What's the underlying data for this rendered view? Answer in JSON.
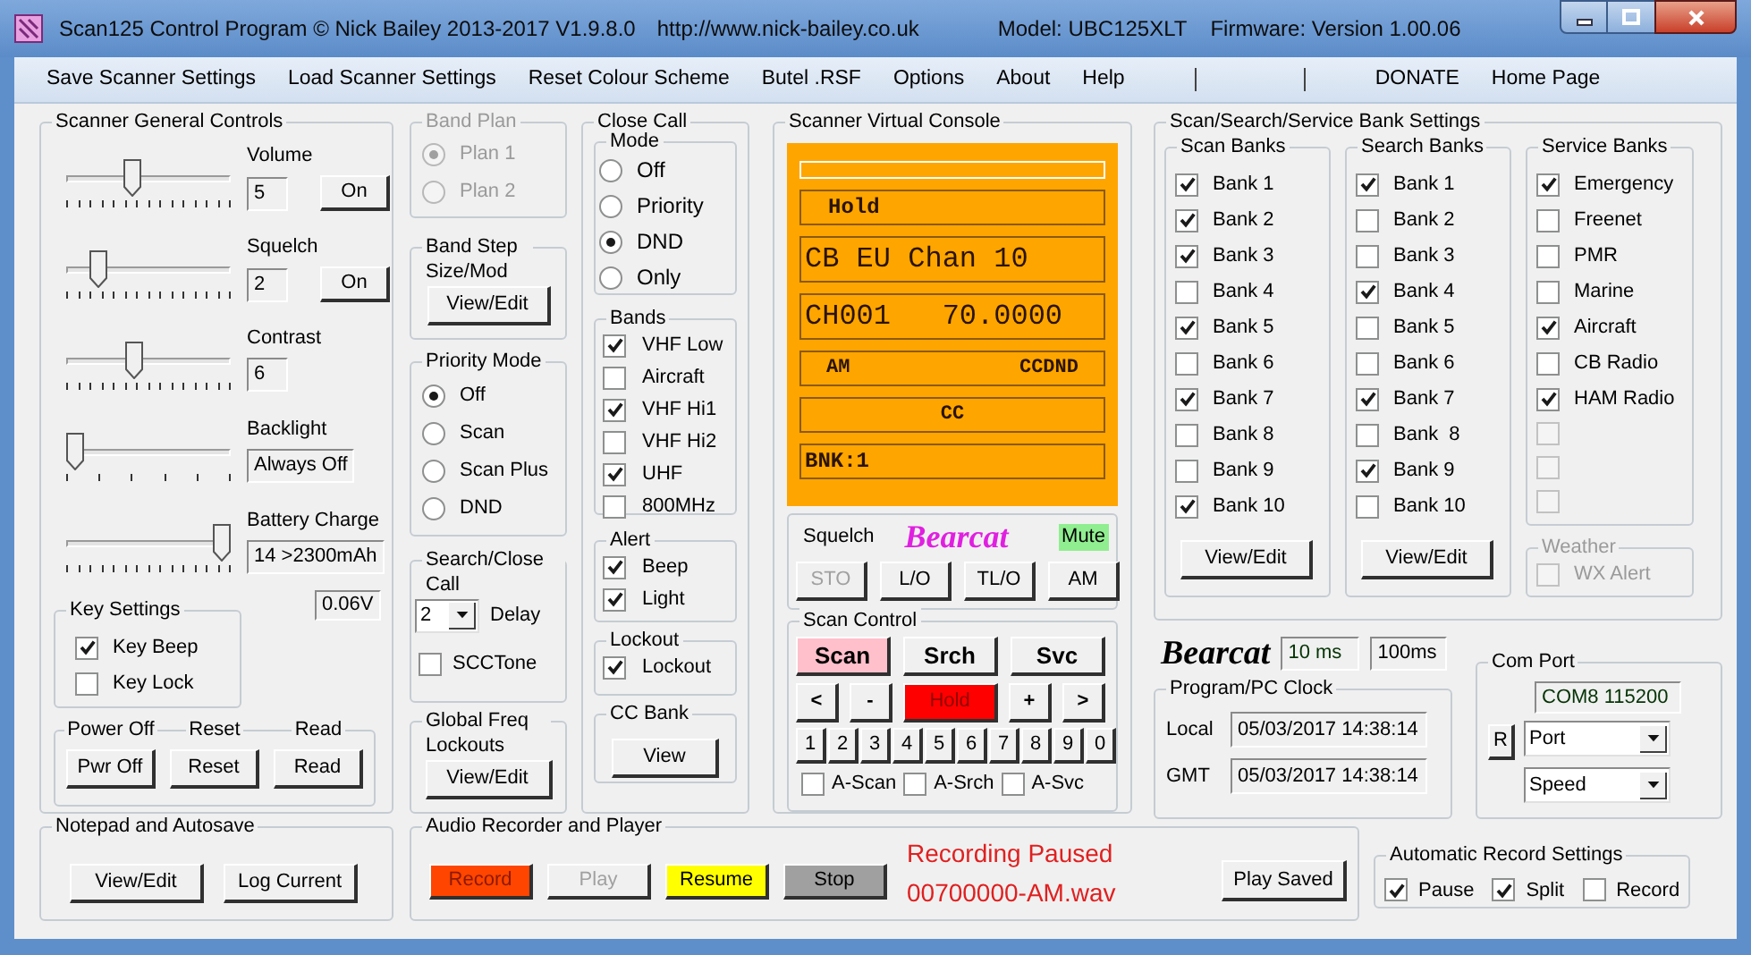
{
  "window": {
    "title": "Scan125 Control Program © Nick Bailey 2013-2017 V1.9.8.0",
    "url": "http://www.nick-bailey.co.uk",
    "model": "Model: UBC125XLT",
    "firmware": "Firmware: Version 1.00.06"
  },
  "menu": [
    {
      "kind": "item",
      "label": "Save Scanner Settings"
    },
    {
      "kind": "item",
      "label": "Load Scanner Settings"
    },
    {
      "kind": "item",
      "label": "Reset Colour Scheme"
    },
    {
      "kind": "item",
      "label": "Butel .RSF"
    },
    {
      "kind": "item",
      "label": "Options"
    },
    {
      "kind": "item",
      "label": "About"
    },
    {
      "kind": "item",
      "label": "Help"
    },
    {
      "kind": "separator"
    },
    {
      "kind": "separator"
    },
    {
      "kind": "item",
      "label": "DONATE"
    },
    {
      "kind": "item",
      "label": "Home Page"
    }
  ],
  "general_controls": {
    "title": "Scanner General Controls",
    "sliders": [
      {
        "kind": "fine",
        "label": "Volume",
        "level": 0.39,
        "value": "5",
        "button": "On"
      },
      {
        "kind": "fine",
        "label": "Squelch",
        "level": 0.16,
        "value": "2",
        "button": "On"
      },
      {
        "kind": "fine",
        "label": "Contrast",
        "level": 0.4,
        "value": "6"
      },
      {
        "kind": "coarse",
        "label": "Backlight",
        "level": 0,
        "value": "Always Off"
      },
      {
        "kind": "fine",
        "label": "Battery Charge",
        "level": 1,
        "value": "14 >2300mAh"
      }
    ],
    "voltage": "0.06V",
    "key_settings": {
      "title": "Key Settings",
      "items": [
        {
          "label": "Key Beep",
          "checked": true
        },
        {
          "label": "Key Lock",
          "checked": false
        }
      ]
    },
    "power": [
      {
        "label": "Power Off",
        "button": "Pwr Off"
      },
      {
        "label": "Reset",
        "button": "Reset"
      },
      {
        "label": "Read",
        "button": "Read"
      }
    ]
  },
  "band_plan": {
    "title": "Band Plan",
    "disabled": true,
    "options": [
      {
        "label": "Plan 1",
        "selected": true
      },
      {
        "label": "Plan 2",
        "selected": false
      }
    ]
  },
  "band_step": {
    "title": "Band Step Size/Mod",
    "button": "View/Edit"
  },
  "priority_mode": {
    "title": "Priority Mode",
    "options": [
      {
        "label": "Off",
        "selected": true
      },
      {
        "label": "Scan",
        "selected": false
      },
      {
        "label": "Scan Plus",
        "selected": false
      },
      {
        "label": "DND",
        "selected": false
      }
    ]
  },
  "search_close_call": {
    "title": "Search/Close Call",
    "delay_value": "2",
    "delay_label": "Delay",
    "scc_tone": {
      "label": "SCCTone",
      "checked": false
    }
  },
  "global_lockouts": {
    "title": "Global Freq Lockouts",
    "button": "View/Edit"
  },
  "close_call": {
    "title": "Close Call",
    "mode": {
      "title": "Mode",
      "options": [
        {
          "label": "Off",
          "selected": false
        },
        {
          "label": "Priority",
          "selected": false
        },
        {
          "label": "DND",
          "selected": true
        },
        {
          "label": "Only",
          "selected": false
        }
      ]
    },
    "bands": {
      "title": "Bands",
      "items": [
        {
          "label": "VHF Low",
          "checked": true
        },
        {
          "label": "Aircraft",
          "checked": false
        },
        {
          "label": "VHF Hi1",
          "checked": true
        },
        {
          "label": "VHF Hi2",
          "checked": false
        },
        {
          "label": "UHF",
          "checked": true
        },
        {
          "label": "800MHz",
          "checked": false
        }
      ]
    },
    "alert": {
      "title": "Alert",
      "items": [
        {
          "label": "Beep",
          "checked": true
        },
        {
          "label": "Light",
          "checked": true
        }
      ]
    },
    "lockout": {
      "title": "Lockout",
      "items": [
        {
          "label": "Lockout",
          "checked": true
        }
      ]
    },
    "cc_bank": {
      "title": "CC Bank",
      "button": "View"
    }
  },
  "console": {
    "title": "Scanner Virtual Console",
    "display": [
      {
        "kind": "blank"
      },
      {
        "kind": "status",
        "text": "Hold"
      },
      {
        "kind": "large",
        "text": "CB EU Chan 10"
      },
      {
        "kind": "large",
        "text": "CH001   70.0000"
      },
      {
        "kind": "split",
        "left": "AM",
        "right": "CCDND"
      },
      {
        "kind": "center",
        "text": "CC"
      },
      {
        "kind": "plain",
        "text": "BNK:1"
      }
    ],
    "squelch_label": "Squelch",
    "logo": "Bearcat",
    "mute": "Mute",
    "keys": [
      {
        "label": "STO",
        "disabled": true
      },
      {
        "label": "L/O",
        "disabled": false
      },
      {
        "label": "TL/O",
        "disabled": false
      },
      {
        "label": "AM",
        "disabled": false
      }
    ],
    "scan_control": {
      "title": "Scan Control",
      "modes": [
        {
          "label": "Scan",
          "color": "#ffc0cb"
        },
        {
          "label": "Srch",
          "color": "#f0f0f0"
        },
        {
          "label": "Svc",
          "color": "#f0f0f0"
        }
      ],
      "nav": [
        {
          "label": "<",
          "color": "#f0f0f0"
        },
        {
          "label": "-",
          "color": "#f0f0f0"
        },
        {
          "label": "Hold",
          "color": "#ff0000"
        },
        {
          "label": "+",
          "color": "#f0f0f0"
        },
        {
          "label": ">",
          "color": "#f0f0f0"
        }
      ],
      "digits": [
        "1",
        "2",
        "3",
        "4",
        "5",
        "6",
        "7",
        "8",
        "9",
        "0"
      ],
      "auto": [
        {
          "label": "A-Scan",
          "checked": false
        },
        {
          "label": "A-Srch",
          "checked": false
        },
        {
          "label": "A-Svc",
          "checked": false
        }
      ]
    }
  },
  "bank_settings": {
    "title": "Scan/Search/Service Bank Settings",
    "scan_banks": {
      "title": "Scan Banks",
      "button": "View/Edit",
      "items": [
        {
          "label": "Bank 1",
          "checked": true
        },
        {
          "label": "Bank 2",
          "checked": true
        },
        {
          "label": "Bank 3",
          "checked": true
        },
        {
          "label": "Bank 4",
          "checked": false
        },
        {
          "label": "Bank 5",
          "checked": true
        },
        {
          "label": "Bank 6",
          "checked": false
        },
        {
          "label": "Bank 7",
          "checked": true
        },
        {
          "label": "Bank 8",
          "checked": false
        },
        {
          "label": "Bank 9",
          "checked": false
        },
        {
          "label": "Bank 10",
          "checked": true
        }
      ]
    },
    "search_banks": {
      "title": "Search Banks",
      "button": "View/Edit",
      "items": [
        {
          "label": "Bank 1",
          "checked": true
        },
        {
          "label": "Bank 2",
          "checked": false
        },
        {
          "label": "Bank 3",
          "checked": false
        },
        {
          "label": "Bank 4",
          "checked": true
        },
        {
          "label": "Bank 5",
          "checked": false
        },
        {
          "label": "Bank 6",
          "checked": false
        },
        {
          "label": "Bank 7",
          "checked": true
        },
        {
          "label": "Bank  8",
          "checked": false
        },
        {
          "label": "Bank 9",
          "checked": true
        },
        {
          "label": "Bank 10",
          "checked": false
        }
      ]
    },
    "service_banks": {
      "title": "Service Banks",
      "items": [
        {
          "label": "Emergency",
          "checked": true,
          "disabled": false
        },
        {
          "label": "Freenet",
          "checked": false,
          "disabled": false
        },
        {
          "label": "PMR",
          "checked": false,
          "disabled": false
        },
        {
          "label": "Marine",
          "checked": false,
          "disabled": false
        },
        {
          "label": "Aircraft",
          "checked": true,
          "disabled": false
        },
        {
          "label": "CB Radio",
          "checked": false,
          "disabled": false
        },
        {
          "label": "HAM Radio",
          "checked": true,
          "disabled": false
        },
        {
          "checked": false,
          "disabled": true
        },
        {
          "checked": false,
          "disabled": true
        },
        {
          "checked": false,
          "disabled": true
        }
      ]
    },
    "weather": {
      "title": "Weather",
      "items": [
        {
          "label": "WX Alert",
          "checked": false,
          "disabled": true
        }
      ]
    }
  },
  "timing": {
    "logo": "Bearcat",
    "fast": "10 ms",
    "slow": "100ms"
  },
  "clock": {
    "title": "Program/PC Clock",
    "rows": [
      {
        "label": "Local",
        "value": "05/03/2017 14:38:14"
      },
      {
        "label": "GMT",
        "value": "05/03/2017 14:38:14"
      }
    ]
  },
  "com_port": {
    "title": "Com Port",
    "status": "COM8 115200",
    "reset": "R",
    "port": "Port",
    "speed": "Speed"
  },
  "notepad": {
    "title": "Notepad and Autosave",
    "buttons": [
      "View/Edit",
      "Log Current"
    ]
  },
  "recorder": {
    "title": "Audio Recorder and Player",
    "buttons": [
      {
        "label": "Record",
        "color": "#ff4500",
        "disabled": false
      },
      {
        "label": "Play",
        "color": "#f0f0f0",
        "disabled": true
      },
      {
        "label": "Resume",
        "color": "#ffff00",
        "disabled": false
      },
      {
        "label": "Stop",
        "color": "#a0a0a0",
        "disabled": false
      }
    ],
    "status": "Recording Paused",
    "file": "00700000-AM.wav",
    "play_saved": "Play Saved"
  },
  "auto_record": {
    "title": "Automatic Record Settings",
    "items": [
      {
        "label": "Pause",
        "checked": true
      },
      {
        "label": "Split",
        "checked": true
      },
      {
        "label": "Record",
        "checked": false
      }
    ]
  }
}
